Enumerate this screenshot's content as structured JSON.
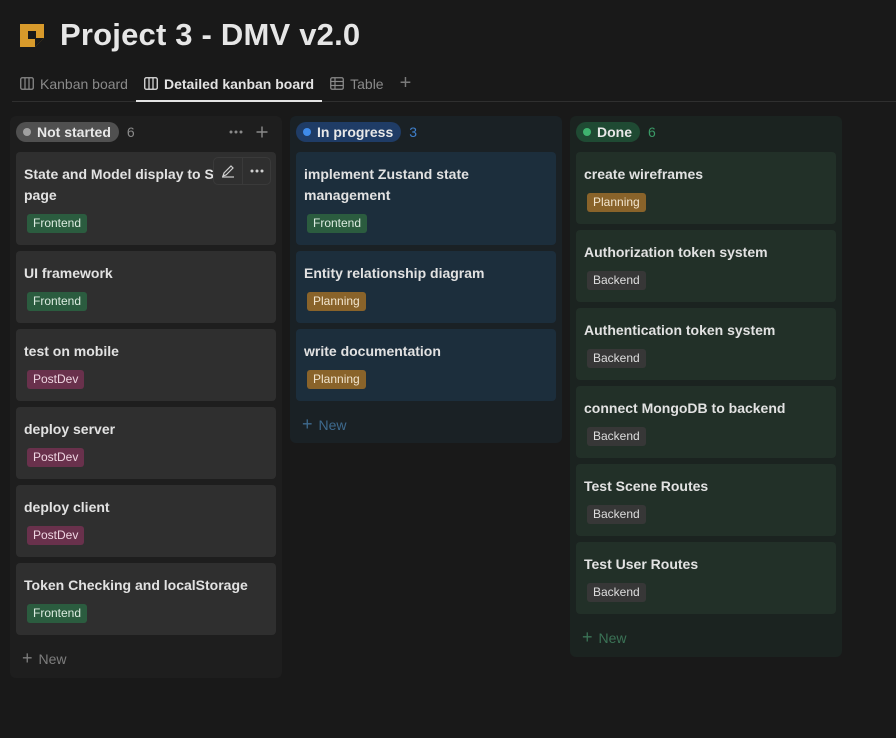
{
  "page": {
    "title": "Project 3 - DMV v2.0",
    "icon": "sticky-note-icon",
    "icon_color": "#d89a2b"
  },
  "tabs": [
    {
      "label": "Kanban board",
      "icon": "board-icon",
      "active": false
    },
    {
      "label": "Detailed kanban board",
      "icon": "board-icon",
      "active": true
    },
    {
      "label": "Table",
      "icon": "table-icon",
      "active": false
    }
  ],
  "columns": {
    "not_started": {
      "label": "Not started",
      "count": "6",
      "color": "#a0a0a0",
      "cards": [
        {
          "title": "State and Model display to Scene page",
          "tag": "Frontend"
        },
        {
          "title": "UI framework",
          "tag": "Frontend"
        },
        {
          "title": "test on mobile",
          "tag": "PostDev"
        },
        {
          "title": "deploy server",
          "tag": "PostDev"
        },
        {
          "title": "deploy client",
          "tag": "PostDev"
        },
        {
          "title": "Token Checking and localStorage",
          "tag": "Frontend"
        }
      ],
      "new_label": "New"
    },
    "in_progress": {
      "label": "In progress",
      "count": "3",
      "color": "#3f8bea",
      "cards": [
        {
          "title": "implement Zustand state management",
          "tag": "Frontend"
        },
        {
          "title": "Entity relationship diagram",
          "tag": "Planning"
        },
        {
          "title": "write documentation",
          "tag": "Planning"
        }
      ],
      "new_label": "New"
    },
    "done": {
      "label": "Done",
      "count": "6",
      "color": "#3fb36f",
      "cards": [
        {
          "title": "create wireframes",
          "tag": "Planning"
        },
        {
          "title": "Authorization token system",
          "tag": "Backend"
        },
        {
          "title": "Authentication token system",
          "tag": "Backend"
        },
        {
          "title": "connect MongoDB to backend",
          "tag": "Backend"
        },
        {
          "title": "Test Scene Routes",
          "tag": "Backend"
        },
        {
          "title": "Test User Routes",
          "tag": "Backend"
        }
      ],
      "new_label": "New"
    }
  },
  "tag_colors": {
    "Frontend": "#2b5c3f",
    "PostDev": "#69314c",
    "Planning": "#89632a",
    "Backend": "#373737"
  }
}
